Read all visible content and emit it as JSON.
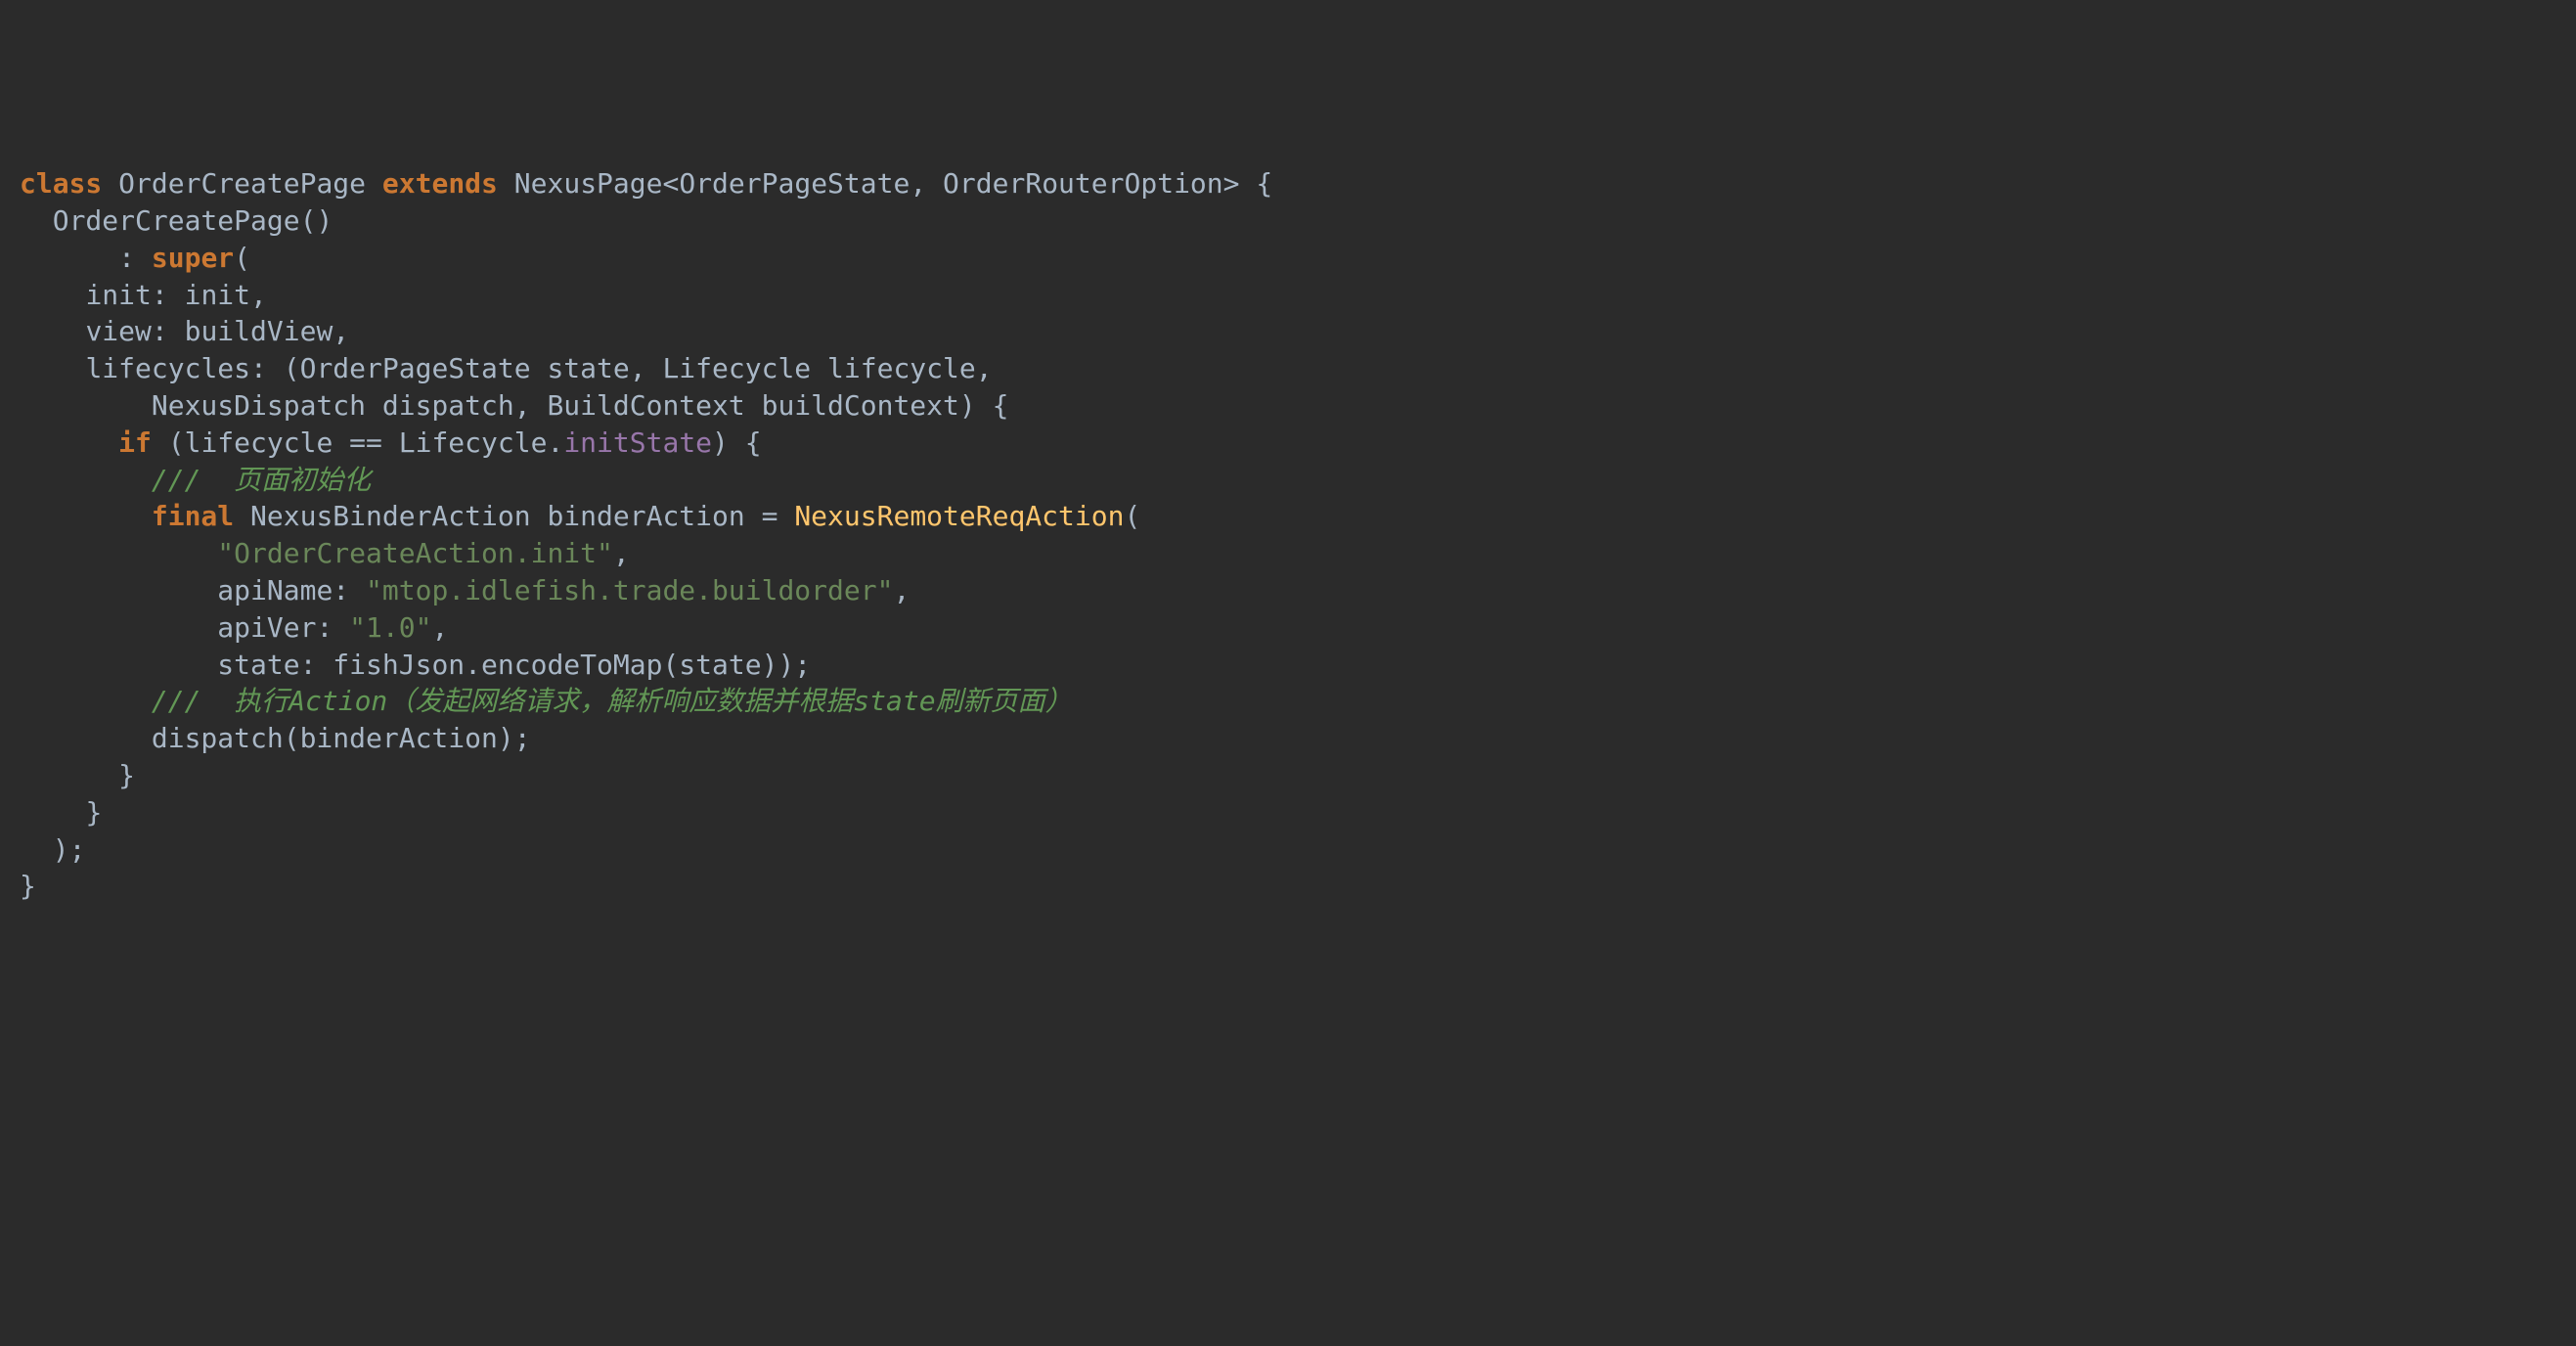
{
  "code": {
    "line1": {
      "kw_class": "class",
      "class_name": "OrderCreatePage",
      "kw_extends": "extends",
      "base_type": "NexusPage<OrderPageState, OrderRouterOption> {"
    },
    "line2": {
      "ctor": "OrderCreatePage()"
    },
    "line3": {
      "colon": ":",
      "kw_super": "super",
      "open": "("
    },
    "line4": {
      "text": "init: init,"
    },
    "line5": {
      "text": "view: buildView,"
    },
    "line6": {
      "text": "lifecycles: (OrderPageState state, Lifecycle lifecycle,"
    },
    "line7": {
      "text": "NexusDispatch dispatch, BuildContext buildContext) {"
    },
    "line8": {
      "kw_if": "if",
      "cond_open": " (lifecycle == Lifecycle.",
      "member": "initState",
      "cond_close": ") {"
    },
    "line9": {
      "comment": "///  页面初始化"
    },
    "line10": {
      "kw_final": "final",
      "decl": " NexusBinderAction binderAction = ",
      "call": "NexusRemoteReqAction",
      "open": "("
    },
    "line11": {
      "str": "\"OrderCreateAction.init\"",
      "comma": ","
    },
    "line12": {
      "label": "apiName: ",
      "str": "\"mtop.idlefish.trade.buildorder\"",
      "comma": ","
    },
    "line13": {
      "label": "apiVer: ",
      "str": "\"1.0\"",
      "comma": ","
    },
    "line14": {
      "text": "state: fishJson.encodeToMap(state));"
    },
    "line15": {
      "comment": "///  执行Action（发起网络请求，解析响应数据并根据state刷新页面）"
    },
    "line16": {
      "text": "dispatch(binderAction);"
    },
    "line17": {
      "text": "}"
    },
    "line18": {
      "text": "}"
    },
    "line19": {
      "text": ");"
    },
    "line20": {
      "text": "}"
    }
  }
}
